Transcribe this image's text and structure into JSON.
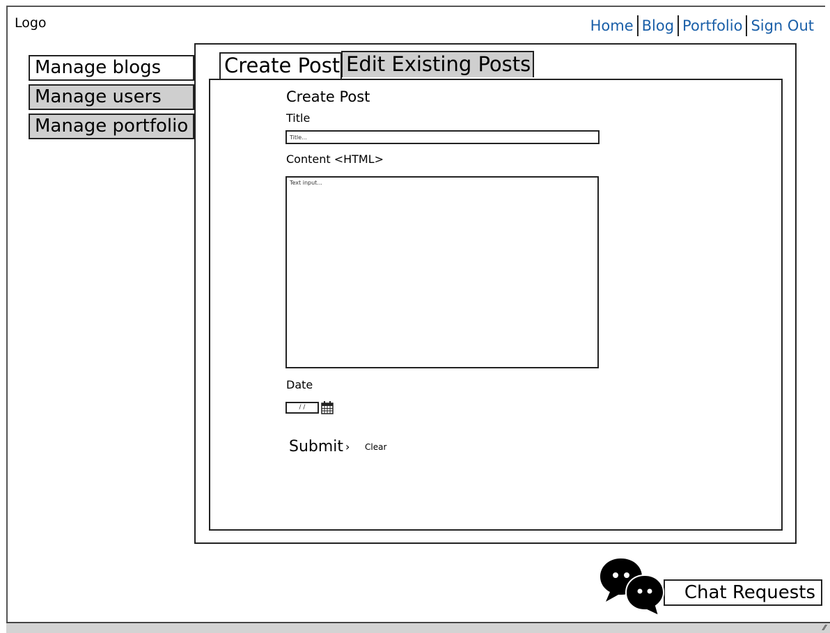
{
  "header": {
    "logo": "Logo",
    "nav": [
      {
        "label": "Home"
      },
      {
        "label": "Blog"
      },
      {
        "label": "Portfolio"
      },
      {
        "label": "Sign Out"
      }
    ]
  },
  "sidebar": {
    "items": [
      {
        "label": "Manage blogs",
        "active": true
      },
      {
        "label": "Manage users",
        "active": false
      },
      {
        "label": "Manage portfolio",
        "active": false
      }
    ]
  },
  "tabs": [
    {
      "label": "Create Post",
      "active": true
    },
    {
      "label": "Edit Existing Posts",
      "active": false
    }
  ],
  "form": {
    "heading": "Create Post",
    "title_label": "Title",
    "title_placeholder": "Title...",
    "content_label": "Content <HTML>",
    "content_placeholder": "Text input...",
    "date_label": "Date",
    "date_value": "/ /",
    "submit_label": "Submit",
    "submit_arrow": "›",
    "clear_label": "Clear"
  },
  "chat": {
    "label": "Chat Requests"
  },
  "icons": {
    "calendar": "calendar-icon",
    "chat": "chat-bubbles-icon",
    "resize": "resize-grip-icon"
  },
  "colors": {
    "nav_link": "#1a5fa8",
    "inactive_bg": "#cfcfcf"
  }
}
